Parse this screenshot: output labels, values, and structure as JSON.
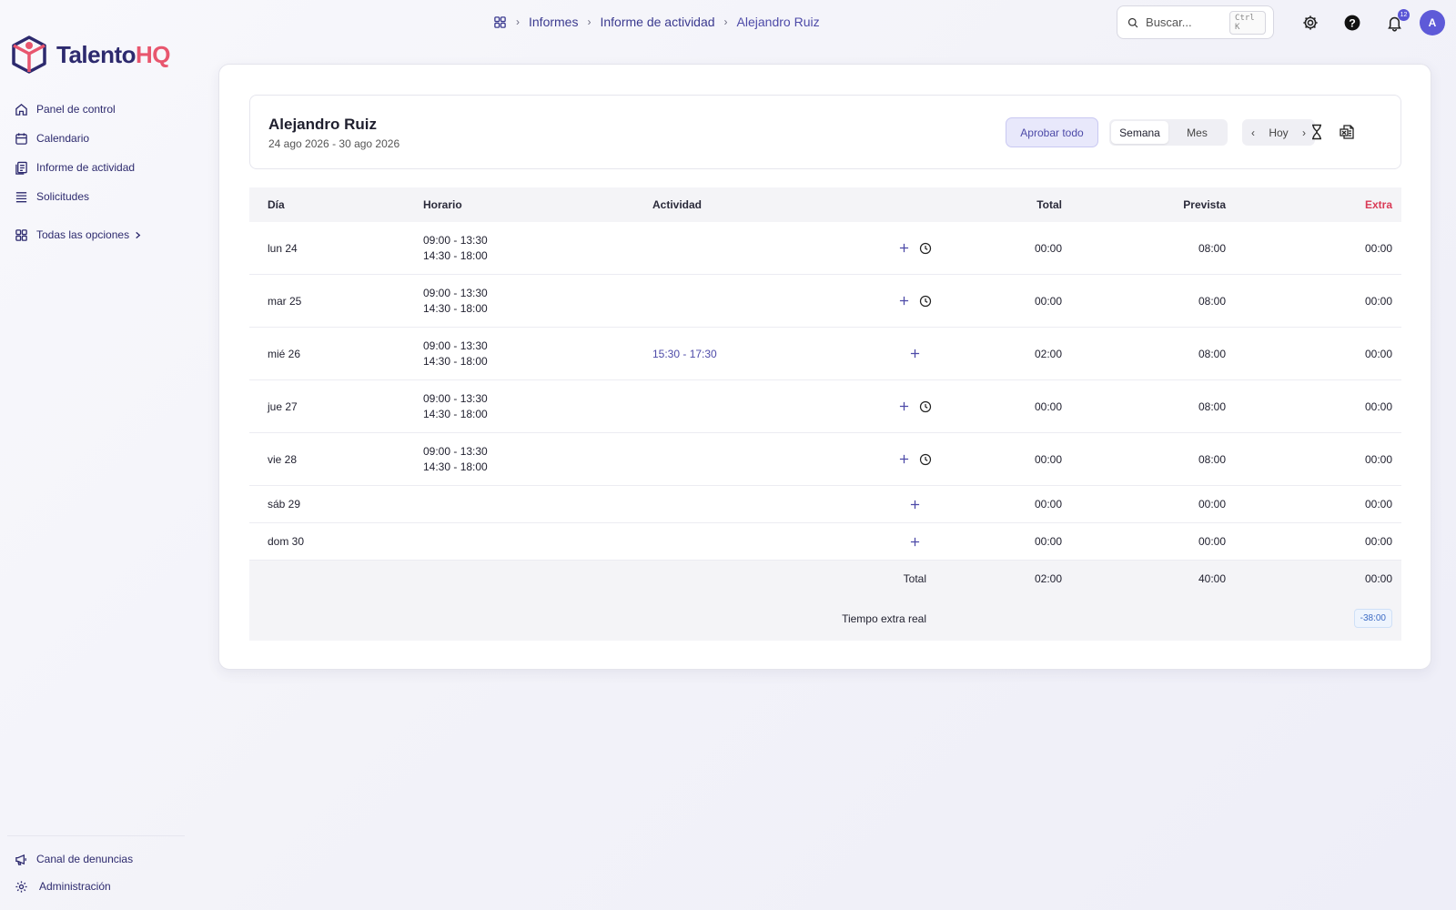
{
  "brand": {
    "name_a": "Talento",
    "name_b": "HQ",
    "color_a": "#2d2a6e",
    "color_b": "#e8566e"
  },
  "sidebar": {
    "items": [
      {
        "label": "Panel de control",
        "icon": "home-icon"
      },
      {
        "label": "Calendario",
        "icon": "calendar-icon"
      },
      {
        "label": "Informe de actividad",
        "icon": "report-icon"
      },
      {
        "label": "Solicitudes",
        "icon": "list-icon"
      }
    ],
    "all_options": "Todas las opciones",
    "bottom": [
      {
        "label": "Canal de denuncias",
        "icon": "megaphone-icon"
      },
      {
        "label": "Administración",
        "icon": "gear-icon"
      }
    ]
  },
  "breadcrumb": {
    "items": [
      "Informes",
      "Informe de actividad"
    ],
    "current": "Alejandro Ruiz"
  },
  "search": {
    "placeholder": "Buscar...",
    "shortcut": "Ctrl K"
  },
  "notifications": {
    "count": "12"
  },
  "user": {
    "initial": "A"
  },
  "header": {
    "name": "Alejandro Ruiz",
    "range": "24 ago 2026 - 30 ago 2026",
    "approve_label": "Aprobar todo",
    "view_week": "Semana",
    "view_month": "Mes",
    "today": "Hoy"
  },
  "table": {
    "columns": {
      "day": "Día",
      "schedule": "Horario",
      "activity": "Actividad",
      "total": "Total",
      "planned": "Prevista",
      "extra": "Extra"
    },
    "rows": [
      {
        "day": "lun 24",
        "s1": "09:00 - 13:30",
        "s2": "14:30 - 18:00",
        "activity": "",
        "total": "00:00",
        "planned": "08:00",
        "extra": "00:00"
      },
      {
        "day": "mar 25",
        "s1": "09:00 - 13:30",
        "s2": "14:30 - 18:00",
        "activity": "",
        "total": "00:00",
        "planned": "08:00",
        "extra": "00:00"
      },
      {
        "day": "mié 26",
        "s1": "09:00 - 13:30",
        "s2": "14:30 - 18:00",
        "activity": "15:30 - 17:30",
        "total": "02:00",
        "planned": "08:00",
        "extra": "00:00"
      },
      {
        "day": "jue 27",
        "s1": "09:00 - 13:30",
        "s2": "14:30 - 18:00",
        "activity": "",
        "total": "00:00",
        "planned": "08:00",
        "extra": "00:00"
      },
      {
        "day": "vie 28",
        "s1": "09:00 - 13:30",
        "s2": "14:30 - 18:00",
        "activity": "",
        "total": "00:00",
        "planned": "08:00",
        "extra": "00:00"
      },
      {
        "day": "sáb 29",
        "s1": "",
        "s2": "",
        "activity": "",
        "total": "00:00",
        "planned": "00:00",
        "extra": "00:00"
      },
      {
        "day": "dom 30",
        "s1": "",
        "s2": "",
        "activity": "",
        "total": "00:00",
        "planned": "00:00",
        "extra": "00:00"
      }
    ],
    "footer": {
      "total_label": "Total",
      "total": "02:00",
      "planned": "40:00",
      "extra": "00:00",
      "real_extra_label": "Tiempo extra real",
      "real_extra": "-38:00"
    }
  }
}
